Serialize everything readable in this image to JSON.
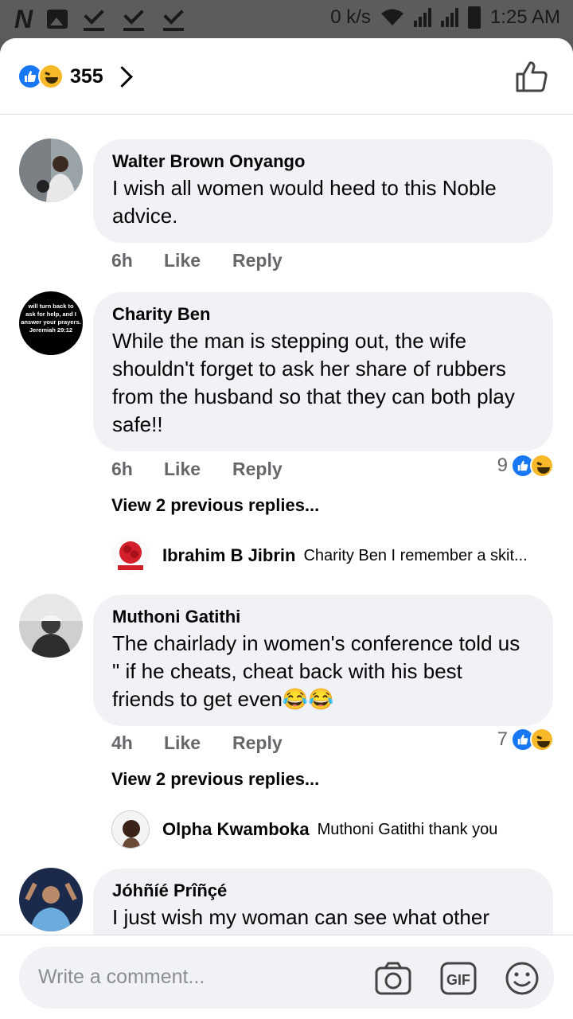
{
  "status_bar": {
    "speed": "0 k/s",
    "time": "1:25 AM"
  },
  "header": {
    "reaction_count": "355"
  },
  "comments": [
    {
      "name": "Walter Brown Onyango",
      "lines": [
        "I wish all women would heed to this Noble",
        "advice."
      ],
      "time": "6h",
      "like": "Like",
      "reply": "Reply"
    },
    {
      "name": "Charity Ben",
      "avatar_text": [
        "will turn back to",
        "ask for help, and I",
        "answer your prayers.",
        "Jeremiah 29:12"
      ],
      "lines": [
        "While the man is stepping out, the wife",
        "shouldn't forget to ask her share of rubbers",
        "from the husband so that they can both play",
        "safe!!"
      ],
      "time": "6h",
      "like": "Like",
      "reply": "Reply",
      "reaction_count": "9",
      "view_replies": "View 2 previous replies...",
      "latest_reply": {
        "name": "Ibrahim B Jibrin",
        "text": "Charity Ben I remember a skit..."
      }
    },
    {
      "name": "Muthoni Gatithi",
      "lines": [
        "The chairlady in women's conference told us",
        "\" if he cheats, cheat back with his best",
        "friends to get even😂😂"
      ],
      "time": "4h",
      "like": "Like",
      "reply": "Reply",
      "reaction_count": "7",
      "view_replies": "View 2 previous replies...",
      "latest_reply": {
        "name": "Olpha Kwamboka",
        "text": "Muthoni Gatithi thank you"
      }
    },
    {
      "name": "Jóhñíé Prîñçé",
      "lines": [
        "I just wish my woman can see what other"
      ]
    }
  ],
  "composer": {
    "placeholder": "Write a comment...",
    "icons": [
      "camera-icon",
      "gif-icon",
      "emoji-icon"
    ]
  },
  "colors": {
    "like_blue": "#1877f2",
    "haha_yellow": "#f7b928",
    "bubble_bg": "#f0f2f5",
    "meta_gray": "#65676b"
  }
}
